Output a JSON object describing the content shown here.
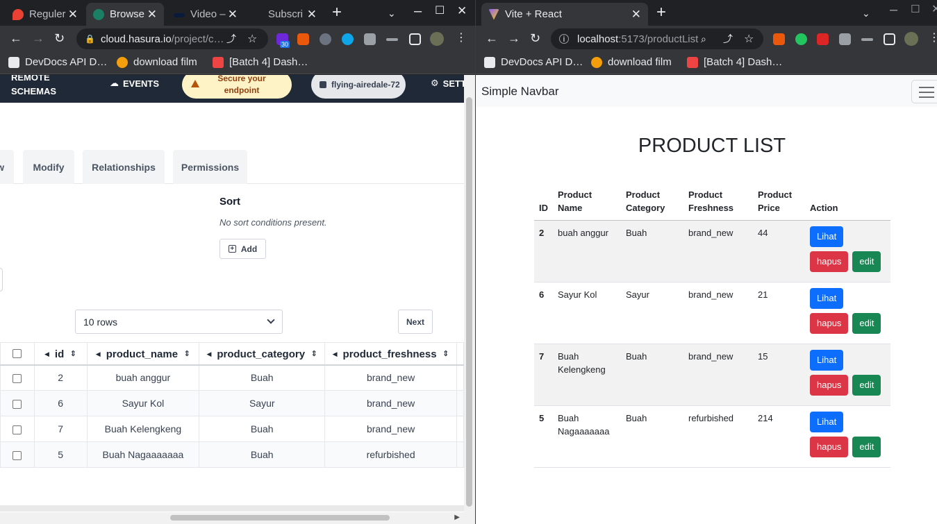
{
  "left_window": {
    "tabs": [
      {
        "title": "Reguler",
        "color": "#e94235"
      },
      {
        "title": "Browse",
        "color": "#1a7f64"
      },
      {
        "title": "Video –",
        "color": "#0a1a3a"
      },
      {
        "title": "Subscri",
        "color": "#202124"
      }
    ],
    "url_host": "cloud.hasura.io",
    "url_path": "/project/c…",
    "ext_badge": "30",
    "bookmarks": [
      "DevDocs API D…",
      "download film",
      "[Batch 4] Dash…"
    ]
  },
  "right_window": {
    "tabs": [
      {
        "title": "Vite + React",
        "color": "#8b5cf6"
      }
    ],
    "url_host": "localhost",
    "url_path": ":5173/productList",
    "bookmarks": [
      "DevDocs API D…",
      "download film",
      "[Batch 4] Dash…"
    ]
  },
  "hasura": {
    "nav": {
      "remote_schemas": "REMOTE SCHEMAS",
      "events": "EVENTS",
      "secure": "Secure your endpoint",
      "project": "flying-airedale-72",
      "settings": "SETT"
    },
    "tabs": [
      "w",
      "Modify",
      "Relationships",
      "Permissions"
    ],
    "sort": {
      "heading": "Sort",
      "empty": "No sort conditions present.",
      "add_label": "Add"
    },
    "rows_select": "10 rows",
    "next_label": "Next",
    "columns": [
      "id",
      "product_name",
      "product_category",
      "product_freshness"
    ],
    "rows": [
      [
        "2",
        "buah anggur",
        "Buah",
        "brand_new"
      ],
      [
        "6",
        "Sayur Kol",
        "Sayur",
        "brand_new"
      ],
      [
        "7",
        "Buah Kelengkeng",
        "Buah",
        "brand_new"
      ],
      [
        "5",
        "Buah Nagaaaaaaa",
        "Buah",
        "refurbished"
      ]
    ]
  },
  "react": {
    "brand": "Simple Navbar",
    "title": "PRODUCT LIST",
    "headers": [
      "ID",
      "Product Name",
      "Product Category",
      "Product Freshness",
      "Product Price",
      "Action"
    ],
    "rows": [
      [
        "2",
        "buah anggur",
        "Buah",
        "brand_new",
        "44"
      ],
      [
        "6",
        "Sayur Kol",
        "Sayur",
        "brand_new",
        "21"
      ],
      [
        "7",
        "Buah Kelengkeng",
        "Buah",
        "brand_new",
        "15"
      ],
      [
        "5",
        "Buah Nagaaaaaaa",
        "Buah",
        "refurbished",
        "214"
      ]
    ],
    "actions": {
      "view": "Lihat",
      "delete": "hapus",
      "edit": "edit"
    }
  }
}
